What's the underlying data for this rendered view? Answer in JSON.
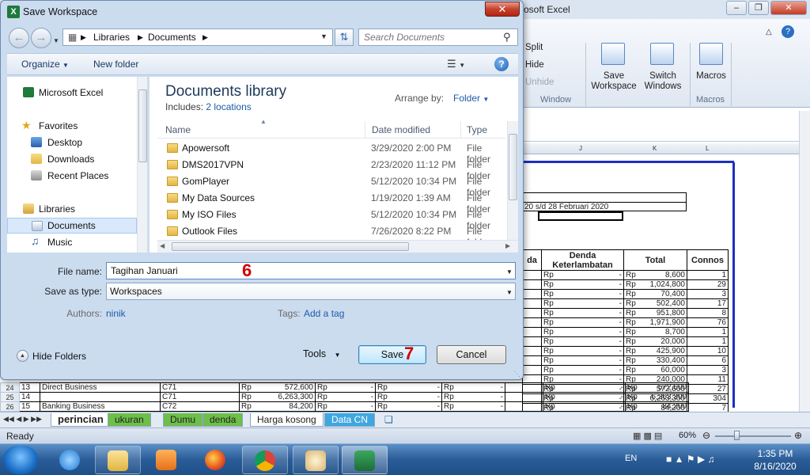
{
  "excel": {
    "title": "osoft Excel",
    "ribbon": {
      "split": "Split",
      "hide": "Hide",
      "unhide": "Unhide",
      "window_group": "Window",
      "save_workspace": "Save Workspace",
      "switch_windows": "Switch Windows",
      "macros": "Macros",
      "macros_group": "Macros"
    },
    "col_headers": [
      "J",
      "K",
      "L"
    ],
    "date_range_text": "20 s/d 28 Februari 2020",
    "headers": {
      "h1": "da",
      "h2": "Denda Keterlambatan",
      "h3": "Total",
      "h4": "Connos"
    },
    "rows": [
      {
        "denda": "-",
        "total": "8,600",
        "connos": "1"
      },
      {
        "denda": "-",
        "total": "1,024,800",
        "connos": "29"
      },
      {
        "denda": "-",
        "total": "70,400",
        "connos": "3"
      },
      {
        "denda": "-",
        "total": "502,400",
        "connos": "17"
      },
      {
        "denda": "-",
        "total": "951,800",
        "connos": "8"
      },
      {
        "denda": "-",
        "total": "1,971,900",
        "connos": "76"
      },
      {
        "denda": "-",
        "total": "8,700",
        "connos": "1"
      },
      {
        "denda": "-",
        "total": "20,000",
        "connos": "1"
      },
      {
        "denda": "-",
        "total": "425,900",
        "connos": "10"
      },
      {
        "denda": "-",
        "total": "330,400",
        "connos": "6"
      },
      {
        "denda": "-",
        "total": "60,000",
        "connos": "3"
      },
      {
        "denda": "-",
        "total": "240,000",
        "connos": "11"
      },
      {
        "denda": "-",
        "total": "572,600",
        "connos": "27"
      },
      {
        "denda": "-",
        "total": "6,263,300",
        "connos": "304"
      },
      {
        "denda": "-",
        "total": "84,200",
        "connos": "7"
      }
    ],
    "rp": "Rp",
    "lower_rows": [
      {
        "rownum": "24",
        "no": "13",
        "name": "Direct Business",
        "code": "C71",
        "amount": "572,600"
      },
      {
        "rownum": "25",
        "no": "14",
        "name": "",
        "code": "C71",
        "amount": "6,263,300"
      },
      {
        "rownum": "26",
        "no": "15",
        "name": "Banking Business",
        "code": "C72",
        "amount": "84,200"
      }
    ],
    "tabs": [
      "perincian",
      "Dumu",
      "denda",
      "Harga kosong",
      "Data CN"
    ],
    "tab_partial": "ukuran",
    "status": {
      "ready": "Ready",
      "zoom": "60%"
    }
  },
  "taskbar": {
    "lang": "EN",
    "time": "1:35 PM",
    "date": "8/16/2020"
  },
  "dialog": {
    "title": "Save Workspace",
    "address": {
      "part1": "Libraries",
      "part2": "Documents"
    },
    "search_placeholder": "Search Documents",
    "organize": "Organize",
    "new_folder": "New folder",
    "nav": {
      "excel": "Microsoft Excel",
      "favorites": "Favorites",
      "desktop": "Desktop",
      "downloads": "Downloads",
      "recent": "Recent Places",
      "libraries": "Libraries",
      "documents": "Documents",
      "music": "Music"
    },
    "library_title": "Documents library",
    "includes_label": "Includes:",
    "includes_link": "2 locations",
    "arrange_label": "Arrange by:",
    "arrange_value": "Folder",
    "columns": {
      "name": "Name",
      "date": "Date modified",
      "type": "Type"
    },
    "files": [
      {
        "name": "Apowersoft",
        "date": "3/29/2020 2:00 PM",
        "type": "File folder"
      },
      {
        "name": "DMS2017VPN",
        "date": "2/23/2020 11:12 PM",
        "type": "File folder"
      },
      {
        "name": "GomPlayer",
        "date": "5/12/2020 10:34 PM",
        "type": "File folder"
      },
      {
        "name": "My Data Sources",
        "date": "1/19/2020 1:39 AM",
        "type": "File folder"
      },
      {
        "name": "My ISO Files",
        "date": "5/12/2020 10:34 PM",
        "type": "File folder"
      },
      {
        "name": "Outlook Files",
        "date": "7/26/2020 8:22 PM",
        "type": "File folder"
      }
    ],
    "file_name_label": "File name:",
    "file_name_value": "Tagihan Januari",
    "save_as_label": "Save as type:",
    "save_as_value": "Workspaces",
    "authors_label": "Authors:",
    "authors_value": "ninik",
    "tags_label": "Tags:",
    "tags_value": "Add a tag",
    "hide_folders": "Hide Folders",
    "tools": "Tools",
    "save": "Save",
    "cancel": "Cancel",
    "step6": "6",
    "step7": "7"
  }
}
